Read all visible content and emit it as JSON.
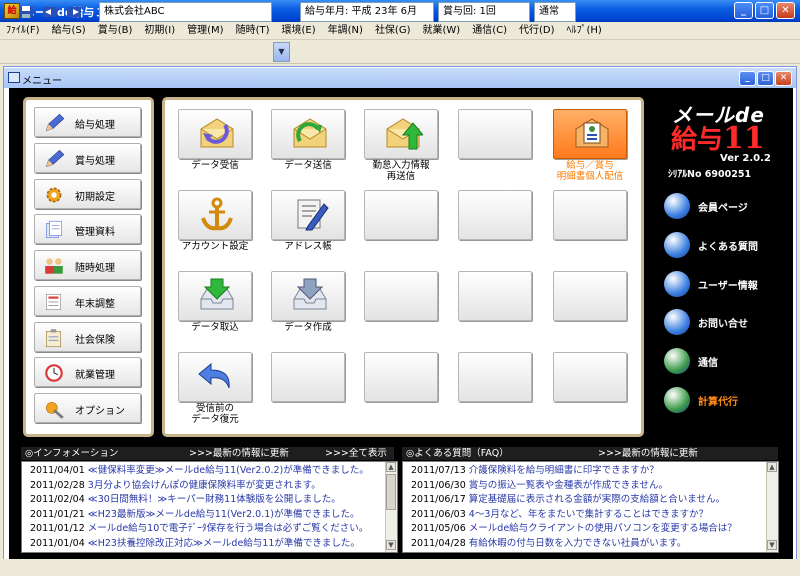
{
  "window": {
    "title": "メールde給与１１"
  },
  "menus": [
    "ﾌｧｲﾙ(F)",
    "給与(S)",
    "賞与(B)",
    "初期(I)",
    "管理(M)",
    "随時(T)",
    "環境(E)",
    "年調(N)",
    "社保(G)",
    "就業(W)",
    "通信(C)",
    "代行(D)",
    "ﾍﾙﾌﾟ(H)"
  ],
  "toolbar": {
    "company": "株式会社ABC",
    "pay_month": "給与年月: 平成 23年  6月",
    "bonus_count": "賞与回: 1回",
    "mode": "通常"
  },
  "child_window": {
    "title": "メニュー"
  },
  "sidebar": [
    {
      "label": "給与処理",
      "icon": "pencil-icon"
    },
    {
      "label": "賞与処理",
      "icon": "pencil-icon"
    },
    {
      "label": "初期設定",
      "icon": "gear-icon"
    },
    {
      "label": "管理資料",
      "icon": "documents-icon"
    },
    {
      "label": "随時処理",
      "icon": "people-icon"
    },
    {
      "label": "年末調整",
      "icon": "form-icon"
    },
    {
      "label": "社会保険",
      "icon": "clipboard-icon"
    },
    {
      "label": "就業管理",
      "icon": "clock-icon"
    },
    {
      "label": "オプション",
      "icon": "wrench-icon"
    }
  ],
  "tiles": [
    {
      "label": "データ受信",
      "icon": "receive-mail-icon"
    },
    {
      "label": "データ送信",
      "icon": "send-mail-icon"
    },
    {
      "label": "勤怠入力情報\n再送信",
      "icon": "resend-mail-icon"
    },
    {
      "label": "",
      "icon": ""
    },
    {
      "label": "給与／賞与\n明細書個人配信",
      "icon": "payslip-mail-icon",
      "highlight": true
    },
    {
      "label": "アカウント設定",
      "icon": "anchor-icon"
    },
    {
      "label": "アドレス帳",
      "icon": "address-book-icon"
    },
    {
      "label": "",
      "icon": ""
    },
    {
      "label": "",
      "icon": ""
    },
    {
      "label": "",
      "icon": ""
    },
    {
      "label": "データ取込",
      "icon": "import-tray-icon"
    },
    {
      "label": "データ作成",
      "icon": "create-tray-icon"
    },
    {
      "label": "",
      "icon": ""
    },
    {
      "label": "",
      "icon": ""
    },
    {
      "label": "",
      "icon": ""
    },
    {
      "label": "受信前の\nデータ復元",
      "icon": "undo-arrow-icon"
    },
    {
      "label": "",
      "icon": ""
    },
    {
      "label": "",
      "icon": ""
    },
    {
      "label": "",
      "icon": ""
    },
    {
      "label": "",
      "icon": ""
    }
  ],
  "brand": {
    "line1": "メールde",
    "line2a": "給与",
    "line2b": "11",
    "version": "Ver 2.0.2",
    "serial": "ｼﾘｱﾙNo 6900251"
  },
  "right_links": [
    {
      "label": "会員ページ",
      "icon": "member-icon"
    },
    {
      "label": "よくある質問",
      "icon": "faq-icon"
    },
    {
      "label": "ユーザー情報",
      "icon": "info-icon"
    },
    {
      "label": "お問い合せ",
      "icon": "contact-icon"
    },
    {
      "label": "通信",
      "icon": "globe-icon"
    },
    {
      "label": "計算代行",
      "icon": "globe-icon",
      "highlight": true
    }
  ],
  "info_news": {
    "title": "◎インフォメーション",
    "update": ">>>最新の情報に更新",
    "show_all": ">>>全て表示",
    "rows": [
      {
        "date": "2011/04/01",
        "text": "≪健保料率変更≫メールde給与11(Ver2.0.2)が準備できました。"
      },
      {
        "date": "2011/02/28",
        "text": "3月分より協会けんぽの健康保険料率が変更されます。"
      },
      {
        "date": "2011/02/04",
        "text": "≪30日間無料！≫キーパー財務11体験版を公開しました。"
      },
      {
        "date": "2011/01/21",
        "text": "≪H23最新版≫メールde給与11(Ver2.0.1)が準備できました。"
      },
      {
        "date": "2011/01/12",
        "text": "メールde給与10で電子ﾃﾞｰﾀ保存を行う場合は必ずご覧ください。"
      },
      {
        "date": "2011/01/04",
        "text": "≪H23扶養控除改正対応≫メールde給与11が準備できました。"
      }
    ]
  },
  "faq_news": {
    "title": "◎よくある質問（FAQ）",
    "update": ">>>最新の情報に更新",
    "rows": [
      {
        "date": "2011/07/13",
        "text": "介護保険料を給与明細書に印字できますか？"
      },
      {
        "date": "2011/06/30",
        "text": "賞与の振込一覧表や金種表が作成できません。"
      },
      {
        "date": "2011/06/17",
        "text": "算定基礎届に表示される金額が実際の支給額と合いません。"
      },
      {
        "date": "2011/06/03",
        "text": "4～3月など、年をまたいで集計することはできますか？"
      },
      {
        "date": "2011/05/06",
        "text": "メールde給与クライアントの使用パソコンを変更する場合は？"
      },
      {
        "date": "2011/04/28",
        "text": "有給休暇の付与日数を入力できない社員がいます。"
      }
    ]
  },
  "colors": {
    "titlebar": "#0a5ee0",
    "panel_border": "#c7b48a",
    "client_bg": "#000000",
    "link": "#2838a8",
    "highlight": "#ff7a1c"
  }
}
